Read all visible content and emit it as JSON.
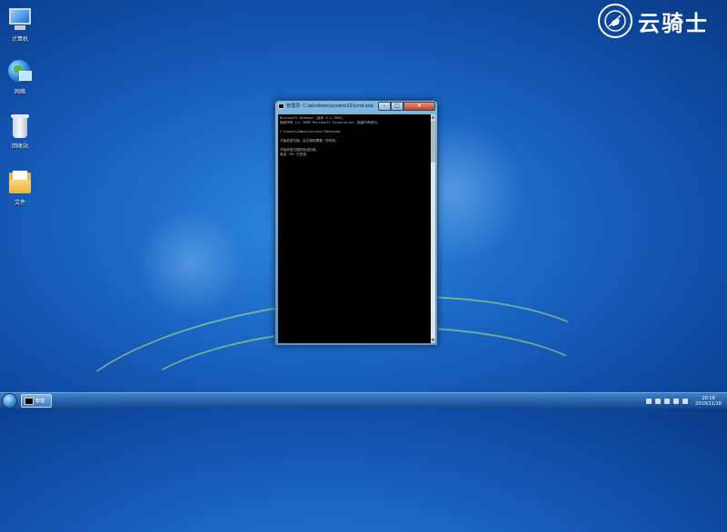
{
  "desktop": {
    "icons": [
      {
        "label": "计算机",
        "icon": "computer-icon"
      },
      {
        "label": "网络",
        "icon": "network-icon"
      },
      {
        "label": "回收站",
        "icon": "recycle-bin-icon"
      },
      {
        "label": "文件",
        "icon": "folder-icon"
      }
    ],
    "logo_text": "云骑士"
  },
  "cmd": {
    "title": "管理员: C:\\windows\\system32\\cmd.exe",
    "min_label": "–",
    "max_label": "□",
    "close_label": "×",
    "lines": [
      "Microsoft Windows [版本 6.1.7601]",
      "版权所有 (c) 2009 Microsoft Corporation。保留所有权利。",
      "",
      "C:\\Users\\Administrator\\Desktop>",
      "",
      "开始系统扫描。此过程将需要一些时间。",
      "",
      "开始系统扫描的验证阶段。",
      "验证 76% 已完成。"
    ]
  },
  "taskbar": {
    "task_label": "管理",
    "time": "20:18",
    "date": "2019/11/18"
  },
  "colors": {
    "desktop": "#1c69c8",
    "console_bg": "#000000",
    "close_button": "#c2402a"
  }
}
